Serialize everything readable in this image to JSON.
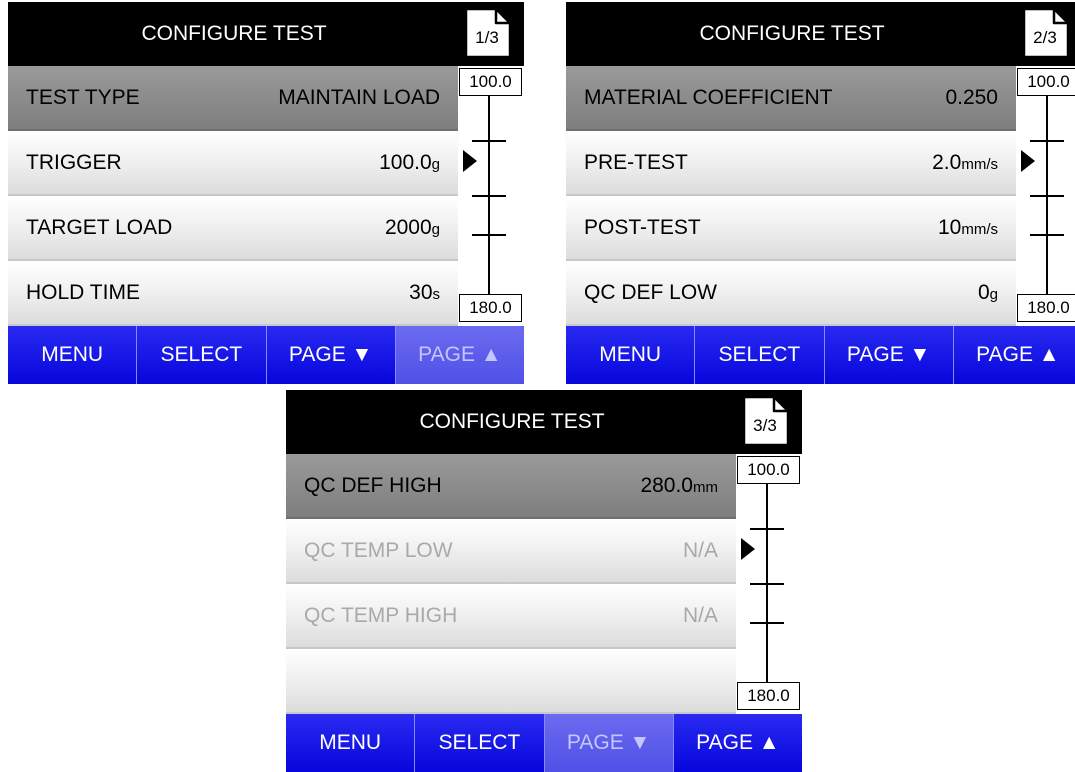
{
  "screens": [
    {
      "title": "CONFIGURE TEST",
      "page_indicator": "1/3",
      "rows": [
        {
          "label": "TEST TYPE",
          "value": "MAINTAIN LOAD",
          "unit": "",
          "selected": true,
          "disabled": false
        },
        {
          "label": "TRIGGER",
          "value": "100.0",
          "unit": "g",
          "selected": false,
          "disabled": false
        },
        {
          "label": "TARGET LOAD",
          "value": "2000",
          "unit": "g",
          "selected": false,
          "disabled": false
        },
        {
          "label": "HOLD TIME",
          "value": "30",
          "unit": "s",
          "selected": false,
          "disabled": false
        }
      ],
      "scroll": {
        "top_label": "100.0",
        "bottom_label": "180.0"
      },
      "buttons": [
        {
          "label": "MENU",
          "dimmed": false
        },
        {
          "label": "SELECT",
          "dimmed": false
        },
        {
          "label": "PAGE ▼",
          "dimmed": false
        },
        {
          "label": "PAGE ▲",
          "dimmed": true
        }
      ]
    },
    {
      "title": "CONFIGURE TEST",
      "page_indicator": "2/3",
      "rows": [
        {
          "label": "MATERIAL COEFFICIENT",
          "value": "0.250",
          "unit": "",
          "selected": true,
          "disabled": false
        },
        {
          "label": "PRE-TEST",
          "value": "2.0",
          "unit": "mm/s",
          "selected": false,
          "disabled": false
        },
        {
          "label": "POST-TEST",
          "value": "10",
          "unit": "mm/s",
          "selected": false,
          "disabled": false
        },
        {
          "label": "QC DEF LOW",
          "value": "0",
          "unit": "g",
          "selected": false,
          "disabled": false
        }
      ],
      "scroll": {
        "top_label": "100.0",
        "bottom_label": "180.0"
      },
      "buttons": [
        {
          "label": "MENU",
          "dimmed": false
        },
        {
          "label": "SELECT",
          "dimmed": false
        },
        {
          "label": "PAGE ▼",
          "dimmed": false
        },
        {
          "label": "PAGE ▲",
          "dimmed": false
        }
      ]
    },
    {
      "title": "CONFIGURE TEST",
      "page_indicator": "3/3",
      "rows": [
        {
          "label": "QC DEF HIGH",
          "value": "280.0",
          "unit": "mm",
          "selected": true,
          "disabled": false
        },
        {
          "label": "QC TEMP LOW",
          "value": "N/A",
          "unit": "",
          "selected": false,
          "disabled": true
        },
        {
          "label": "QC TEMP HIGH",
          "value": "N/A",
          "unit": "",
          "selected": false,
          "disabled": true
        },
        {
          "label": "",
          "value": "",
          "unit": "",
          "selected": false,
          "disabled": false
        }
      ],
      "scroll": {
        "top_label": "100.0",
        "bottom_label": "180.0"
      },
      "buttons": [
        {
          "label": "MENU",
          "dimmed": false
        },
        {
          "label": "SELECT",
          "dimmed": false
        },
        {
          "label": "PAGE ▼",
          "dimmed": true
        },
        {
          "label": "PAGE ▲",
          "dimmed": false
        }
      ]
    }
  ],
  "colors": {
    "button_blue": "#0606dc",
    "button_dimmed": "#5050e6",
    "selected_row": "#7e7e7e",
    "titlebar": "#000000",
    "disabled_text": "#a9a9a9"
  },
  "icons": {
    "page": "page-icon",
    "pointer": "triangle-right-icon"
  }
}
